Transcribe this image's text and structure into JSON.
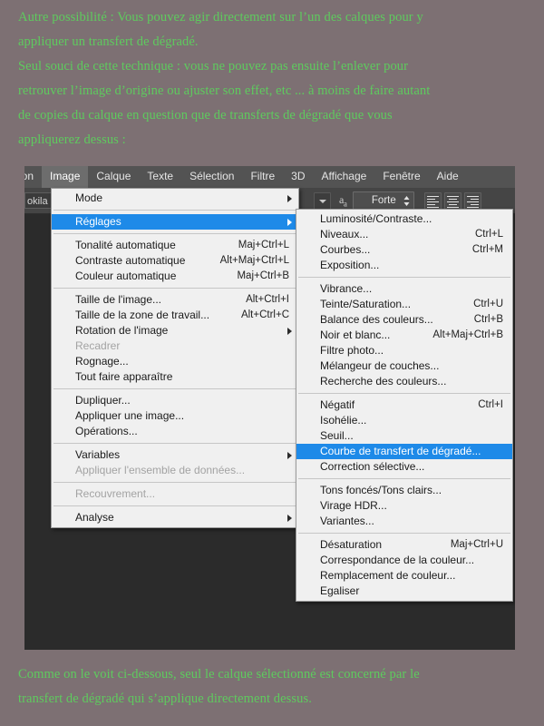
{
  "colors": {
    "page_background": "#7d7073",
    "prose_text": "#5ecb5e",
    "menu_background": "#f0f0f0",
    "menu_highlight": "#1e8ae8",
    "menu_highlight_text": "#ffffff",
    "app_background": "#2b2b2b",
    "menubar_background": "#535353",
    "disabled_text": "#a3a3a3"
  },
  "prose_top": [
    "Autre possibilité : Vous pouvez agir directement sur l’un des calques pour y",
    "appliquer un transfert de dégradé.",
    "Seul souci de cette technique : vous ne pouvez pas ensuite l’enlever pour",
    "retrouver l’image d’origine ou ajuster son effet, etc ... à moins de faire autant",
    "de copies du calque en question que de transferts de dégradé que vous",
    "appliquerez dessus :"
  ],
  "prose_bottom": [
    "Comme on le voit ci-dessous, seul le calque sélectionné est concerné par le",
    "transfert de dégradé qui s’applique directement dessus."
  ],
  "menubar": {
    "items": [
      {
        "label": "ion",
        "active": false,
        "truncated": true
      },
      {
        "label": "Image",
        "active": true,
        "truncated": false
      },
      {
        "label": "Calque",
        "active": false,
        "truncated": false
      },
      {
        "label": "Texte",
        "active": false,
        "truncated": false
      },
      {
        "label": "Sélection",
        "active": false,
        "truncated": false
      },
      {
        "label": "Filtre",
        "active": false,
        "truncated": false
      },
      {
        "label": "3D",
        "active": false,
        "truncated": false
      },
      {
        "label": "Affichage",
        "active": false,
        "truncated": false
      },
      {
        "label": "Fenêtre",
        "active": false,
        "truncated": false
      },
      {
        "label": "Aide",
        "active": false,
        "truncated": false
      }
    ]
  },
  "options_bar": {
    "font_name_truncated": "okila",
    "antialias_icon_label": "a",
    "antialias_icon_sub": "a",
    "antialias_value": "Forte",
    "align_left_label": "Aligner à gauche",
    "align_center_label": "Centrer",
    "align_right_label": "Aligner à droite"
  },
  "menu_image": {
    "title": "Image",
    "groups": [
      {
        "items": [
          {
            "label": "Mode",
            "shortcut": "",
            "submenu": true,
            "disabled": false,
            "selected": false
          }
        ]
      },
      {
        "items": [
          {
            "label": "Réglages",
            "shortcut": "",
            "submenu": true,
            "disabled": false,
            "selected": true
          }
        ]
      },
      {
        "items": [
          {
            "label": "Tonalité automatique",
            "shortcut": "Maj+Ctrl+L",
            "submenu": false,
            "disabled": false,
            "selected": false
          },
          {
            "label": "Contraste automatique",
            "shortcut": "Alt+Maj+Ctrl+L",
            "submenu": false,
            "disabled": false,
            "selected": false
          },
          {
            "label": "Couleur automatique",
            "shortcut": "Maj+Ctrl+B",
            "submenu": false,
            "disabled": false,
            "selected": false
          }
        ]
      },
      {
        "items": [
          {
            "label": "Taille de l'image...",
            "shortcut": "Alt+Ctrl+I",
            "submenu": false,
            "disabled": false,
            "selected": false
          },
          {
            "label": "Taille de la zone de travail...",
            "shortcut": "Alt+Ctrl+C",
            "submenu": false,
            "disabled": false,
            "selected": false
          },
          {
            "label": "Rotation de l'image",
            "shortcut": "",
            "submenu": true,
            "disabled": false,
            "selected": false
          },
          {
            "label": "Recadrer",
            "shortcut": "",
            "submenu": false,
            "disabled": true,
            "selected": false
          },
          {
            "label": "Rognage...",
            "shortcut": "",
            "submenu": false,
            "disabled": false,
            "selected": false
          },
          {
            "label": "Tout faire apparaître",
            "shortcut": "",
            "submenu": false,
            "disabled": false,
            "selected": false
          }
        ]
      },
      {
        "items": [
          {
            "label": "Dupliquer...",
            "shortcut": "",
            "submenu": false,
            "disabled": false,
            "selected": false
          },
          {
            "label": "Appliquer une image...",
            "shortcut": "",
            "submenu": false,
            "disabled": false,
            "selected": false
          },
          {
            "label": "Opérations...",
            "shortcut": "",
            "submenu": false,
            "disabled": false,
            "selected": false
          }
        ]
      },
      {
        "items": [
          {
            "label": "Variables",
            "shortcut": "",
            "submenu": true,
            "disabled": false,
            "selected": false
          },
          {
            "label": "Appliquer l'ensemble de données...",
            "shortcut": "",
            "submenu": false,
            "disabled": true,
            "selected": false
          }
        ]
      },
      {
        "items": [
          {
            "label": "Recouvrement...",
            "shortcut": "",
            "submenu": false,
            "disabled": true,
            "selected": false
          }
        ]
      },
      {
        "items": [
          {
            "label": "Analyse",
            "shortcut": "",
            "submenu": true,
            "disabled": false,
            "selected": false
          }
        ]
      }
    ]
  },
  "menu_reglages": {
    "title": "Réglages",
    "groups": [
      {
        "items": [
          {
            "label": "Luminosité/Contraste...",
            "shortcut": "",
            "submenu": false,
            "disabled": false,
            "selected": false
          },
          {
            "label": "Niveaux...",
            "shortcut": "Ctrl+L",
            "submenu": false,
            "disabled": false,
            "selected": false
          },
          {
            "label": "Courbes...",
            "shortcut": "Ctrl+M",
            "submenu": false,
            "disabled": false,
            "selected": false
          },
          {
            "label": "Exposition...",
            "shortcut": "",
            "submenu": false,
            "disabled": false,
            "selected": false
          }
        ]
      },
      {
        "items": [
          {
            "label": "Vibrance...",
            "shortcut": "",
            "submenu": false,
            "disabled": false,
            "selected": false
          },
          {
            "label": "Teinte/Saturation...",
            "shortcut": "Ctrl+U",
            "submenu": false,
            "disabled": false,
            "selected": false
          },
          {
            "label": "Balance des couleurs...",
            "shortcut": "Ctrl+B",
            "submenu": false,
            "disabled": false,
            "selected": false
          },
          {
            "label": "Noir et blanc...",
            "shortcut": "Alt+Maj+Ctrl+B",
            "submenu": false,
            "disabled": false,
            "selected": false
          },
          {
            "label": "Filtre photo...",
            "shortcut": "",
            "submenu": false,
            "disabled": false,
            "selected": false
          },
          {
            "label": "Mélangeur de couches...",
            "shortcut": "",
            "submenu": false,
            "disabled": false,
            "selected": false
          },
          {
            "label": "Recherche des couleurs...",
            "shortcut": "",
            "submenu": false,
            "disabled": false,
            "selected": false
          }
        ]
      },
      {
        "items": [
          {
            "label": "Négatif",
            "shortcut": "Ctrl+I",
            "submenu": false,
            "disabled": false,
            "selected": false
          },
          {
            "label": "Isohélie...",
            "shortcut": "",
            "submenu": false,
            "disabled": false,
            "selected": false
          },
          {
            "label": "Seuil...",
            "shortcut": "",
            "submenu": false,
            "disabled": false,
            "selected": false
          },
          {
            "label": "Courbe de transfert de dégradé...",
            "shortcut": "",
            "submenu": false,
            "disabled": false,
            "selected": true
          },
          {
            "label": "Correction sélective...",
            "shortcut": "",
            "submenu": false,
            "disabled": false,
            "selected": false
          }
        ]
      },
      {
        "items": [
          {
            "label": "Tons foncés/Tons clairs...",
            "shortcut": "",
            "submenu": false,
            "disabled": false,
            "selected": false
          },
          {
            "label": "Virage HDR...",
            "shortcut": "",
            "submenu": false,
            "disabled": false,
            "selected": false
          },
          {
            "label": "Variantes...",
            "shortcut": "",
            "submenu": false,
            "disabled": false,
            "selected": false
          }
        ]
      },
      {
        "items": [
          {
            "label": "Désaturation",
            "shortcut": "Maj+Ctrl+U",
            "submenu": false,
            "disabled": false,
            "selected": false
          },
          {
            "label": "Correspondance de la couleur...",
            "shortcut": "",
            "submenu": false,
            "disabled": false,
            "selected": false
          },
          {
            "label": "Remplacement de couleur...",
            "shortcut": "",
            "submenu": false,
            "disabled": false,
            "selected": false
          },
          {
            "label": "Egaliser",
            "shortcut": "",
            "submenu": false,
            "disabled": false,
            "selected": false
          }
        ]
      }
    ]
  }
}
